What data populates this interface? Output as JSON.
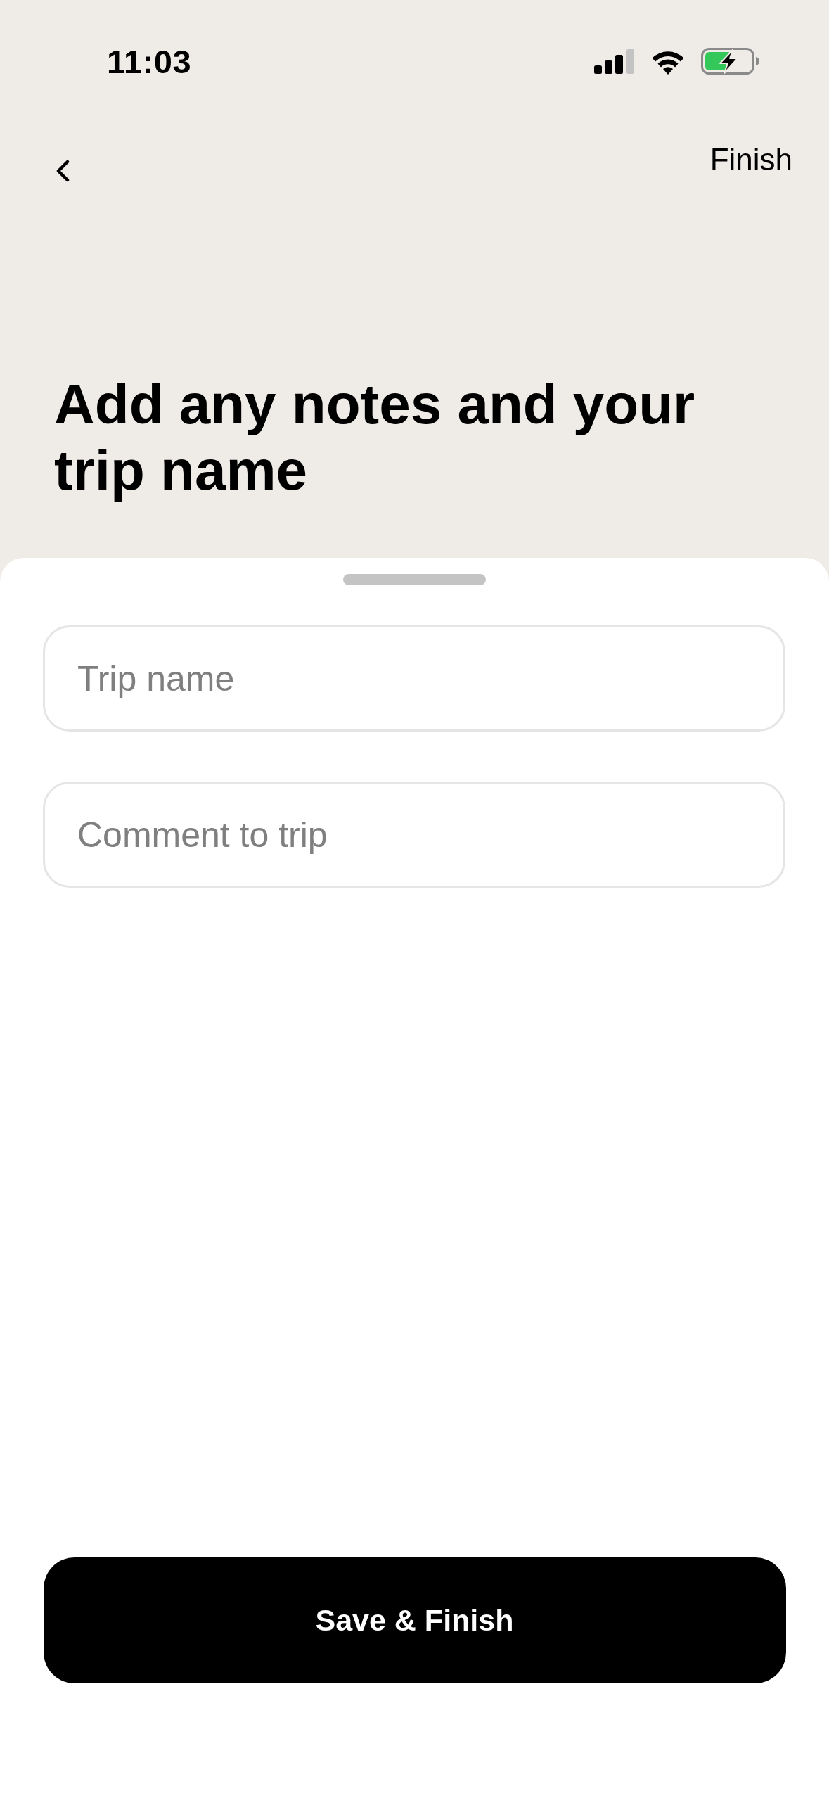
{
  "status_bar": {
    "time": "11:03"
  },
  "nav": {
    "action": "Finish"
  },
  "title": "Add any notes and your trip name",
  "fields": [
    {
      "placeholder": "Trip name"
    },
    {
      "placeholder": "Comment to trip"
    }
  ],
  "primary_button": {
    "label": "Save & Finish"
  }
}
